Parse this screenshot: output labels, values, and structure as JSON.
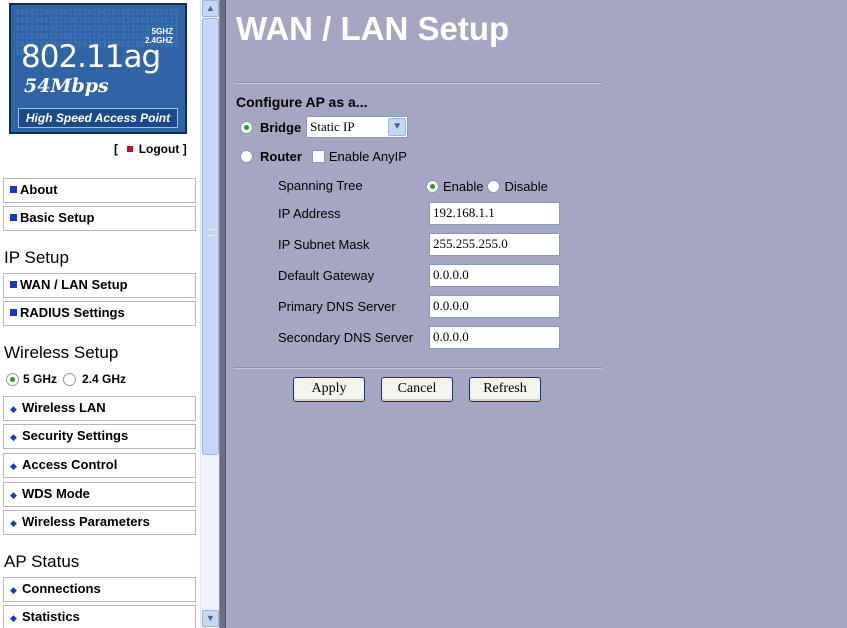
{
  "logo": {
    "band1": "5GHZ",
    "band2": "2.4GHZ",
    "model": "802.11ag",
    "speed": "54Mbps",
    "subtitle": "High Speed Access Point"
  },
  "logout": {
    "open": "[",
    "label": "Logout",
    "close": "]"
  },
  "nav": {
    "about": "About",
    "basic_setup": "Basic Setup",
    "ip_setup_heading": "IP Setup",
    "wan_lan_setup": "WAN / LAN Setup",
    "radius_settings": "RADIUS Settings",
    "wireless_setup_heading": "Wireless Setup",
    "band_5": "5 GHz",
    "band_24": "2.4 GHz",
    "band_selected": "5 GHz",
    "wireless_lan": "Wireless LAN",
    "security_settings": "Security Settings",
    "access_control": "Access Control",
    "wds_mode": "WDS Mode",
    "wireless_parameters": "Wireless Parameters",
    "ap_status_heading": "AP Status",
    "connections": "Connections",
    "statistics": "Statistics"
  },
  "page": {
    "title": "WAN / LAN Setup",
    "config_title": "Configure AP as a...",
    "mode_bridge": "Bridge",
    "mode_router": "Router",
    "mode_selected": "Bridge",
    "bridge_select_value": "Static IP",
    "enable_anyip": "Enable AnyIP",
    "spanning_tree_label": "Spanning Tree",
    "spanning_enable": "Enable",
    "spanning_disable": "Disable",
    "spanning_selected": "Enable",
    "fields": {
      "ip_address": {
        "label": "IP Address",
        "value": "192.168.1.1"
      },
      "subnet_mask": {
        "label": "IP Subnet Mask",
        "value": "255.255.255.0"
      },
      "gateway": {
        "label": "Default Gateway",
        "value": "0.0.0.0"
      },
      "primary_dns": {
        "label": "Primary DNS Server",
        "value": "0.0.0.0"
      },
      "secondary_dns": {
        "label": "Secondary DNS Server",
        "value": "0.0.0.0"
      }
    },
    "buttons": {
      "apply": "Apply",
      "cancel": "Cancel",
      "refresh": "Refresh"
    }
  },
  "colors": {
    "main_bg": "#a6a6c4",
    "logo_bg": "#2f64a6",
    "nav_bullet": "#1838c8",
    "logout_marker": "#e0001a"
  }
}
